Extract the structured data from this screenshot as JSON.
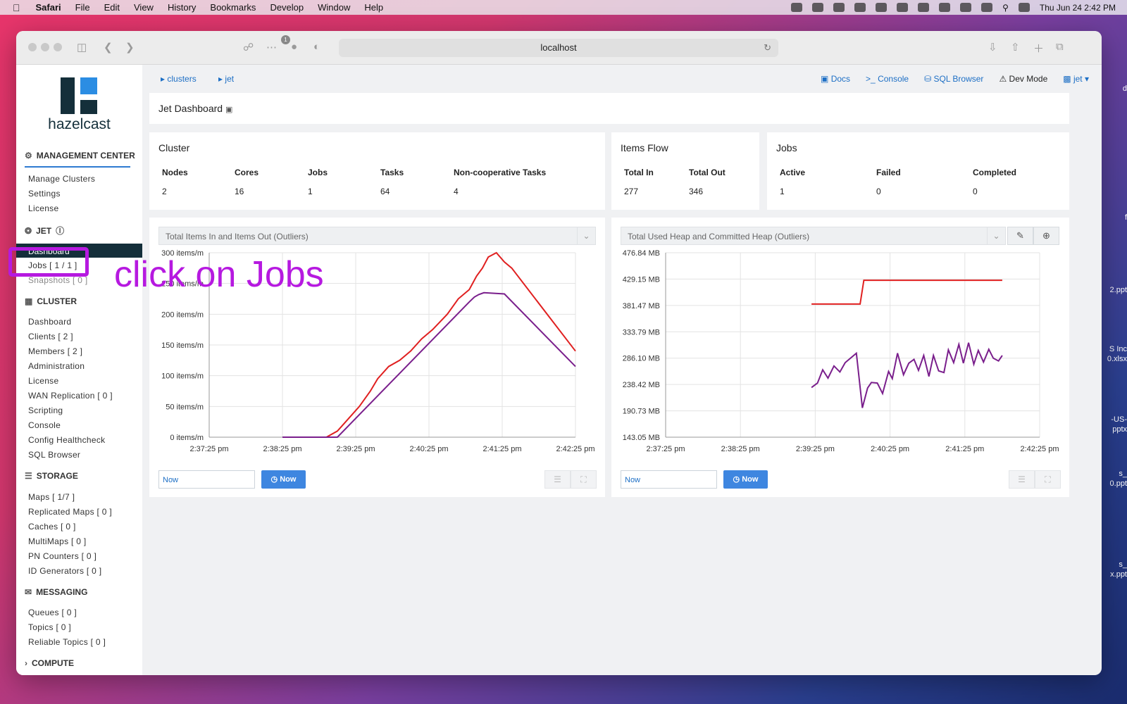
{
  "menubar": {
    "app": "Safari",
    "items": [
      "File",
      "Edit",
      "View",
      "History",
      "Bookmarks",
      "Develop",
      "Window",
      "Help"
    ],
    "clock": "Thu Jun 24  2:42 PM"
  },
  "browser": {
    "url": "localhost",
    "badge": "1"
  },
  "desktop_files": [
    "d",
    "f",
    "2.ppt",
    "S Inc",
    "0.xlsx",
    "-US-",
    "pptx",
    "s_",
    "0.ppt",
    "s_",
    "x.ppt"
  ],
  "sidebar": {
    "brand": "hazelcast",
    "mc_heading": "MANAGEMENT CENTER",
    "mc_items": [
      "Manage Clusters",
      "Settings",
      "License"
    ],
    "jet_heading": "JET",
    "jet_active": "Dashboard",
    "jet_items": [
      "Jobs [ 1 / 1 ]",
      "Snapshots [ 0 ]"
    ],
    "cluster_heading": "CLUSTER",
    "cluster_items": [
      "Dashboard",
      "Clients [ 2 ]",
      "Members [ 2 ]",
      "Administration",
      "License",
      "WAN Replication [ 0 ]",
      "Scripting",
      "Console",
      "Config Healthcheck",
      "SQL Browser"
    ],
    "storage_heading": "STORAGE",
    "storage_items": [
      "Maps [ 1/7 ]",
      "Replicated Maps [ 0 ]",
      "Caches [ 0 ]",
      "MultiMaps [ 0 ]",
      "PN Counters [ 0 ]",
      "ID Generators [ 0 ]"
    ],
    "messaging_heading": "MESSAGING",
    "messaging_items": [
      "Queues [ 0 ]",
      "Topics [ 0 ]",
      "Reliable Topics [ 0 ]"
    ],
    "compute_heading": "COMPUTE"
  },
  "breadcrumb": [
    "clusters",
    "jet"
  ],
  "topnav": {
    "docs": "Docs",
    "console": "Console",
    "sql": "SQL Browser",
    "devmode": "Dev Mode",
    "cluster": "jet"
  },
  "page_title": "Jet Dashboard",
  "cluster_card": {
    "title": "Cluster",
    "headers": [
      "Nodes",
      "Cores",
      "Jobs",
      "Tasks",
      "Non-cooperative Tasks"
    ],
    "values": [
      "2",
      "16",
      "1",
      "64",
      "4"
    ]
  },
  "flow_card": {
    "title": "Items Flow",
    "headers": [
      "Total In",
      "Total Out"
    ],
    "values": [
      "277",
      "346"
    ]
  },
  "jobs_card": {
    "title": "Jobs",
    "headers": [
      "Active",
      "Failed",
      "Completed"
    ],
    "values": [
      "1",
      "0",
      "0"
    ]
  },
  "chart1_select": "Total Items In and Items Out (Outliers)",
  "chart2_select": "Total Used Heap and Committed Heap (Outliers)",
  "controls": {
    "now_input": "Now",
    "now_button": "Now"
  },
  "annotation": "click on Jobs",
  "colors": {
    "red_series": "#e02020",
    "purple_series": "#7a1f8c",
    "navy": "#142f3a",
    "link": "#1d6fc5",
    "annotation": "#b619e0"
  },
  "chart_data": [
    {
      "type": "line",
      "xticks": [
        "2:37:25 pm",
        "2:38:25 pm",
        "2:39:25 pm",
        "2:40:25 pm",
        "2:41:25 pm",
        "2:42:25 pm"
      ],
      "yticks": [
        "0 items/m",
        "50 items/m",
        "100 items/m",
        "150 items/m",
        "200 items/m",
        "250 items/m",
        "300 items/m"
      ],
      "ylim": [
        0,
        300
      ],
      "xlim": [
        0,
        5
      ],
      "series": [
        {
          "color": "#e02020",
          "x": [
            1,
            1.4,
            1.6,
            1.75,
            1.9,
            2.05,
            2.2,
            2.3,
            2.45,
            2.6,
            2.75,
            2.9,
            3.05,
            3.25,
            3.4,
            3.55,
            3.65,
            3.73,
            3.81,
            3.92,
            4.03,
            4.13,
            5
          ],
          "y": [
            0,
            0,
            0,
            10,
            30,
            50,
            75,
            95,
            115,
            125,
            140,
            160,
            175,
            200,
            225,
            240,
            262,
            275,
            293,
            300,
            285,
            275,
            140
          ]
        },
        {
          "color": "#7a1f8c",
          "x": [
            1,
            1.4,
            1.6,
            1.75,
            3.55,
            3.62,
            3.68,
            3.75,
            4.03,
            5
          ],
          "y": [
            0,
            0,
            0,
            0,
            220,
            228,
            232,
            235,
            233,
            115
          ]
        }
      ],
      "grid": true
    },
    {
      "type": "line",
      "xticks": [
        "2:37:25 pm",
        "2:38:25 pm",
        "2:39:25 pm",
        "2:40:25 pm",
        "2:41:25 pm",
        "2:42:25 pm"
      ],
      "yticks": [
        "143.05 MB",
        "190.73 MB",
        "238.42 MB",
        "286.10 MB",
        "333.79 MB",
        "381.47 MB",
        "429.15 MB",
        "476.84 MB"
      ],
      "ylim": [
        143.05,
        476.84
      ],
      "xlim": [
        0,
        5
      ],
      "series": [
        {
          "color": "#e02020",
          "x": [
            1.95,
            2.6,
            2.65,
            4.5
          ],
          "y": [
            384,
            384,
            427,
            427
          ]
        },
        {
          "color": "#7a1f8c",
          "x": [
            1.95,
            2.03,
            2.1,
            2.17,
            2.25,
            2.33,
            2.4,
            2.55,
            2.63,
            2.7,
            2.75,
            2.83,
            2.9,
            2.98,
            3.03,
            3.1,
            3.18,
            3.25,
            3.32,
            3.38,
            3.45,
            3.52,
            3.58,
            3.65,
            3.72,
            3.78,
            3.85,
            3.92,
            3.98,
            4.05,
            4.12,
            4.18,
            4.25,
            4.32,
            4.38,
            4.45,
            4.5
          ],
          "y": [
            233,
            241,
            265,
            250,
            272,
            261,
            278,
            295,
            196,
            232,
            242,
            241,
            222,
            262,
            249,
            295,
            256,
            277,
            284,
            264,
            291,
            253,
            291,
            263,
            260,
            301,
            278,
            311,
            277,
            314,
            275,
            300,
            279,
            302,
            286,
            281,
            291
          ]
        }
      ],
      "grid": true
    }
  ]
}
